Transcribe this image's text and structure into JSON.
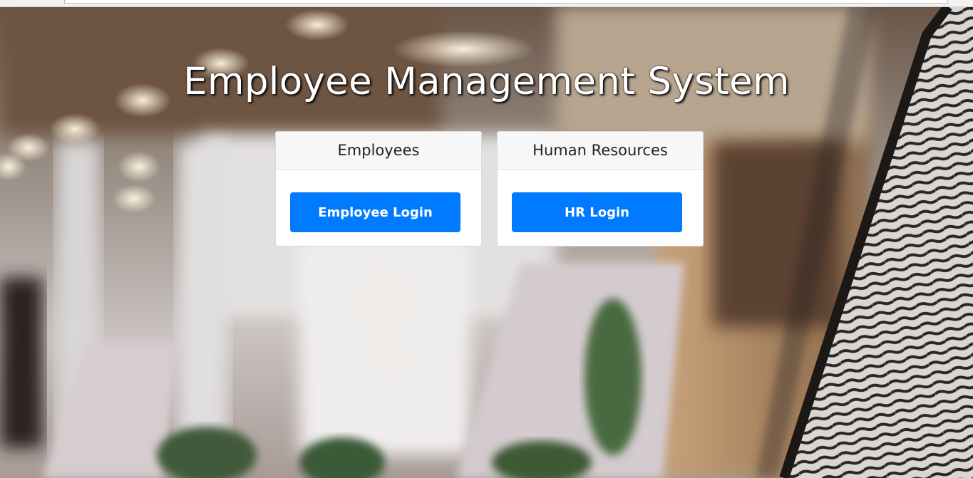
{
  "page": {
    "title": "Employee Management System"
  },
  "cards": {
    "employees": {
      "header": "Employees",
      "button_label": "Employee Login"
    },
    "hr": {
      "header": "Human Resources",
      "button_label": "HR Login"
    }
  },
  "colors": {
    "primary_button": "#007bff",
    "card_header_bg": "#f7f7f7",
    "title_text": "#ffffff"
  }
}
